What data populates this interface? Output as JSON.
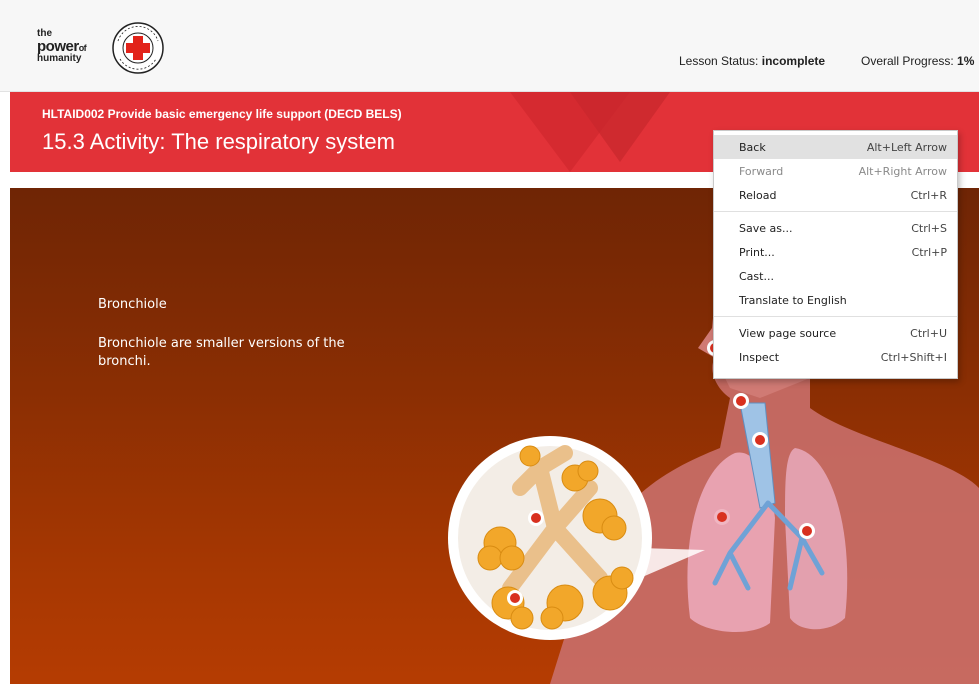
{
  "header": {
    "logo": {
      "line1": "the",
      "line2_main": "power",
      "line2_small": "of",
      "line3": "humanity",
      "badge_text": "AUSTRALIAN RED CROSS"
    },
    "lesson_status_label": "Lesson Status:",
    "lesson_status_value": "incomplete",
    "overall_progress_label": "Overall Progress:",
    "overall_progress_value": "1%"
  },
  "banner": {
    "course": "HLTAID002 Provide basic emergency life support (DECD BELS)",
    "title": "15.3 Activity: The respiratory system"
  },
  "content": {
    "term": "Bronchiole",
    "description": "Bronchiole are smaller versions of the bronchi."
  },
  "context_menu": {
    "items": [
      {
        "label": "Back",
        "shortcut": "Alt+Left Arrow"
      },
      {
        "label": "Forward",
        "shortcut": "Alt+Right Arrow"
      },
      {
        "label": "Reload",
        "shortcut": "Ctrl+R"
      },
      {
        "label": "Save as...",
        "shortcut": "Ctrl+S"
      },
      {
        "label": "Print...",
        "shortcut": "Ctrl+P"
      },
      {
        "label": "Cast...",
        "shortcut": ""
      },
      {
        "label": "Translate to English",
        "shortcut": ""
      },
      {
        "label": "View page source",
        "shortcut": "Ctrl+U"
      },
      {
        "label": "Inspect",
        "shortcut": "Ctrl+Shift+I"
      }
    ]
  },
  "colors": {
    "brand_red": "#e23238",
    "stage_top": "#6f2505",
    "stage_bottom": "#b53c02",
    "hotspot": "#d8301f"
  }
}
